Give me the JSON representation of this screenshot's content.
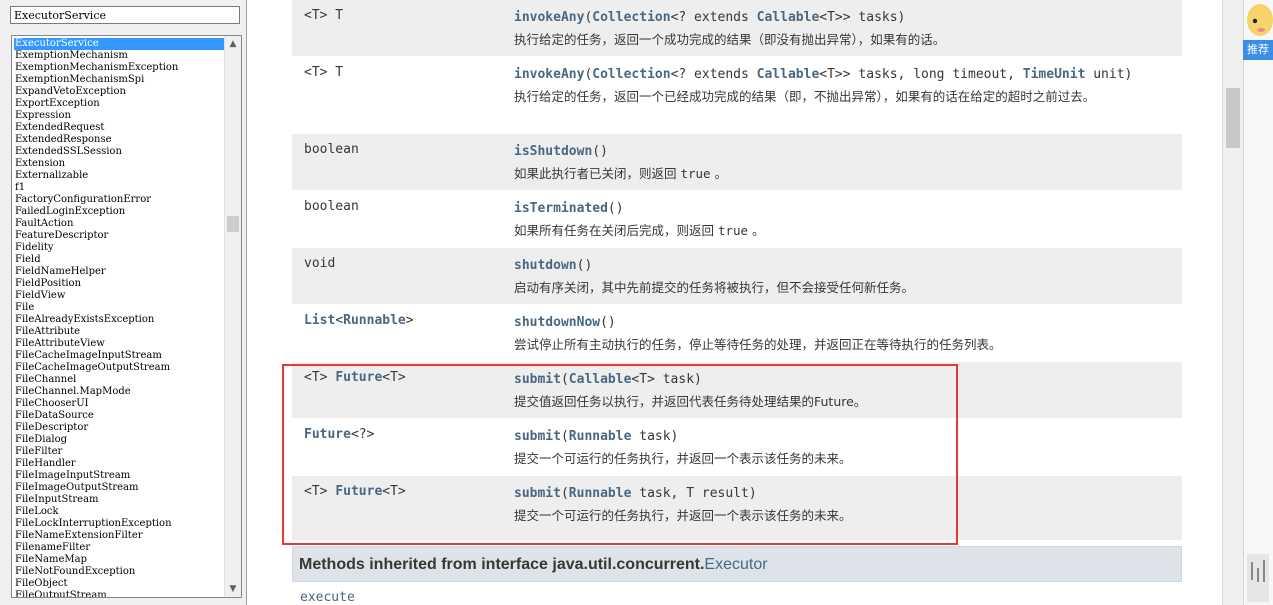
{
  "search": {
    "value": "ExecutorService"
  },
  "class_list": [
    "ExecutorService",
    "ExemptionMechanism",
    "ExemptionMechanismException",
    "ExemptionMechanismSpi",
    "ExpandVetoException",
    "ExportException",
    "Expression",
    "ExtendedRequest",
    "ExtendedResponse",
    "ExtendedSSLSession",
    "Extension",
    "Externalizable",
    "f1",
    "FactoryConfigurationError",
    "FailedLoginException",
    "FaultAction",
    "FeatureDescriptor",
    "Fidelity",
    "Field",
    "FieldNameHelper",
    "FieldPosition",
    "FieldView",
    "File",
    "FileAlreadyExistsException",
    "FileAttribute",
    "FileAttributeView",
    "FileCacheImageInputStream",
    "FileCacheImageOutputStream",
    "FileChannel",
    "FileChannel.MapMode",
    "FileChooserUI",
    "FileDataSource",
    "FileDescriptor",
    "FileDialog",
    "FileFilter",
    "FileHandler",
    "FileImageInputStream",
    "FileImageOutputStream",
    "FileInputStream",
    "FileLock",
    "FileLockInterruptionException",
    "FileNameExtensionFilter",
    "FilenameFilter",
    "FileNameMap",
    "FileNotFoundException",
    "FileObject",
    "FileOutputStream"
  ],
  "selected_class": "ExecutorService",
  "methods": [
    {
      "type": "<T> T",
      "name": "invokeAny",
      "params_html": "(<span class=\"lnk\">Collection</span>&lt;? extends <span class=\"lnk\">Callable</span>&lt;T&gt;&gt; tasks)",
      "desc": "执行给定的任务，返回一个成功完成的结果（即没有抛出异常），如果有的话。",
      "bg": "alt"
    },
    {
      "type": "<T> T",
      "name": "invokeAny",
      "params_html": "(<span class=\"lnk\">Collection</span>&lt;? extends <span class=\"lnk\">Callable</span>&lt;T&gt;&gt; tasks, long timeout, <span class=\"lnk\">TimeUnit</span> unit)",
      "desc": "执行给定的任务，返回一个已经成功完成的结果（即，不抛出异常），如果有的话在给定的超时之前过去。",
      "bg": "plain"
    },
    {
      "type": "boolean",
      "name": "isShutdown",
      "params_html": "()",
      "desc": "如果此执行者已关闭，则返回 <span class=\"mono\">true</span> 。",
      "bg": "alt"
    },
    {
      "type": "boolean",
      "name": "isTerminated",
      "params_html": "()",
      "desc": "如果所有任务在关闭后完成，则返回 <span class=\"mono\">true</span> 。",
      "bg": "plain"
    },
    {
      "type": "void",
      "name": "shutdown",
      "params_html": "()",
      "desc": "启动有序关闭，其中先前提交的任务将被执行，但不会接受任何新任务。",
      "bg": "alt"
    },
    {
      "type_html": "<span class=\"lnk\">List</span>&lt;<span class=\"lnk\">Runnable</span>&gt;",
      "name": "shutdownNow",
      "params_html": "()",
      "desc": "尝试停止所有主动执行的任务，停止等待任务的处理，并返回正在等待执行的任务列表。",
      "bg": "plain"
    },
    {
      "type_html": "&lt;T&gt; <span class=\"lnk\">Future</span>&lt;T&gt;",
      "name": "submit",
      "params_html": "(<span class=\"lnk\">Callable</span>&lt;T&gt; task)",
      "desc": "提交值返回任务以执行，并返回代表任务待处理结果的Future。",
      "bg": "alt"
    },
    {
      "type_html": "<span class=\"lnk\">Future</span>&lt;?&gt;",
      "name": "submit",
      "params_html": "(<span class=\"lnk\">Runnable</span> task)",
      "desc": "提交一个可运行的任务执行，并返回一个表示该任务的未来。",
      "bg": "plain"
    },
    {
      "type_html": "&lt;T&gt; <span class=\"lnk\">Future</span>&lt;T&gt;",
      "name": "submit",
      "params_html": "(<span class=\"lnk\">Runnable</span> task, T result)",
      "desc": "提交一个可运行的任务执行，并返回一个表示该任务的未来。",
      "bg": "alt"
    }
  ],
  "inherited": {
    "prefix": "Methods inherited from interface java.util.concurrent.",
    "link": "Executor",
    "methods": "execute"
  },
  "sidebar_right": {
    "recommend_label": "推荐"
  },
  "colors": {
    "link": "#4a6782",
    "highlight": "#e53935",
    "selection": "#3399ff"
  }
}
